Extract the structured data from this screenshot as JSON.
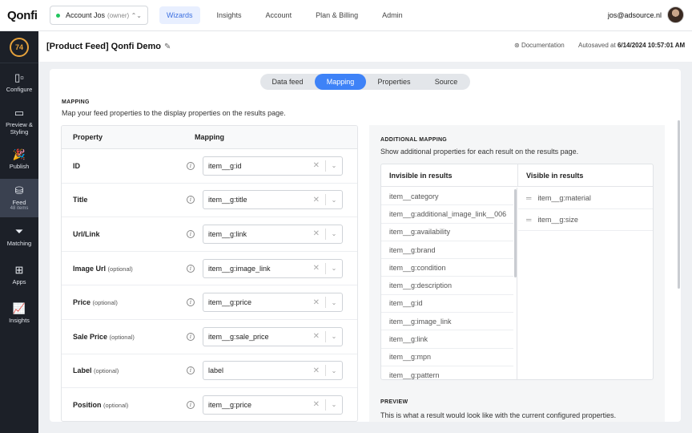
{
  "app": {
    "logo": "Qonfi"
  },
  "account": {
    "name": "Account Jos",
    "role": "(owner)"
  },
  "nav": [
    "Wizards",
    "Insights",
    "Account",
    "Plan & Billing",
    "Admin"
  ],
  "user": {
    "email": "jos@adsource.nl"
  },
  "sidebar": {
    "score": "74",
    "items": [
      {
        "label": "Configure",
        "icon": "configure-icon",
        "sub": ""
      },
      {
        "label": "Preview & Styling",
        "icon": "monitor-icon",
        "sub": ""
      },
      {
        "label": "Publish",
        "icon": "party-popper-icon",
        "sub": ""
      },
      {
        "label": "Feed",
        "icon": "database-icon",
        "sub": "48 items"
      },
      {
        "label": "Matching",
        "icon": "filter-icon",
        "sub": ""
      },
      {
        "label": "Apps",
        "icon": "grid-icon",
        "sub": ""
      },
      {
        "label": "Insights",
        "icon": "chart-icon",
        "sub": ""
      }
    ]
  },
  "header": {
    "title": "[Product Feed] Qonfi Demo",
    "documentation": "Documentation",
    "autosave_label": "Autosaved at",
    "autosave_time": "6/14/2024 10:57:01 AM"
  },
  "tabs": [
    "Data feed",
    "Mapping",
    "Properties",
    "Source"
  ],
  "active_tab": "Mapping",
  "mapping": {
    "label": "MAPPING",
    "description": "Map your feed properties to the display properties on the results page.",
    "col_property": "Property",
    "col_mapping": "Mapping",
    "rows": [
      {
        "property": "ID",
        "optional": "",
        "value": "item__g:id"
      },
      {
        "property": "Title",
        "optional": "",
        "value": "item__g:title"
      },
      {
        "property": "Url/Link",
        "optional": "",
        "value": "item__g:link"
      },
      {
        "property": "Image Url",
        "optional": "(optional)",
        "value": "item__g:image_link"
      },
      {
        "property": "Price",
        "optional": "(optional)",
        "value": "item__g:price"
      },
      {
        "property": "Sale Price",
        "optional": "(optional)",
        "value": "item__g:sale_price"
      },
      {
        "property": "Label",
        "optional": "(optional)",
        "value": "label"
      },
      {
        "property": "Position",
        "optional": "(optional)",
        "value": "item__g:price"
      }
    ]
  },
  "additional": {
    "label": "ADDITIONAL MAPPING",
    "description": "Show additional properties for each result on the results page.",
    "invisible_header": "Invisible in results",
    "visible_header": "Visible in results",
    "invisible": [
      "item__category",
      "item__g:additional_image_link__006",
      "item__g:availability",
      "item__g:brand",
      "item__g:condition",
      "item__g:description",
      "item__g:id",
      "item__g:image_link",
      "item__g:link",
      "item__g:mpn",
      "item__g:pattern"
    ],
    "visible": [
      "item__g:material",
      "item__g:size"
    ]
  },
  "preview": {
    "label": "PREVIEW",
    "description": "This is what a result would look like with the current configured properties."
  }
}
